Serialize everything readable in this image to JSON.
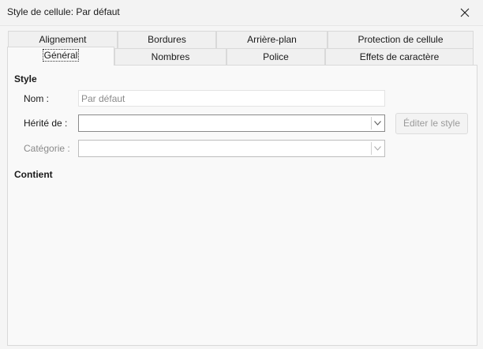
{
  "window": {
    "title": "Style de cellule: Par défaut"
  },
  "tabs": {
    "row_back": [
      "Alignement",
      "Bordures",
      "Arrière-plan",
      "Protection de cellule"
    ],
    "row_front": [
      "Général",
      "Nombres",
      "Police",
      "Effets de caractère"
    ],
    "active": "Général"
  },
  "style_section": {
    "heading": "Style",
    "name_label": "Nom :",
    "name_value": "Par défaut",
    "inherit_label": "Hérité de :",
    "inherit_value": "",
    "edit_button": "Éditer le style",
    "category_label": "Catégorie :",
    "category_value": ""
  },
  "contains_section": {
    "heading": "Contient"
  },
  "icons": {
    "close": "close-icon",
    "dropdown": "chevron-down-icon"
  }
}
